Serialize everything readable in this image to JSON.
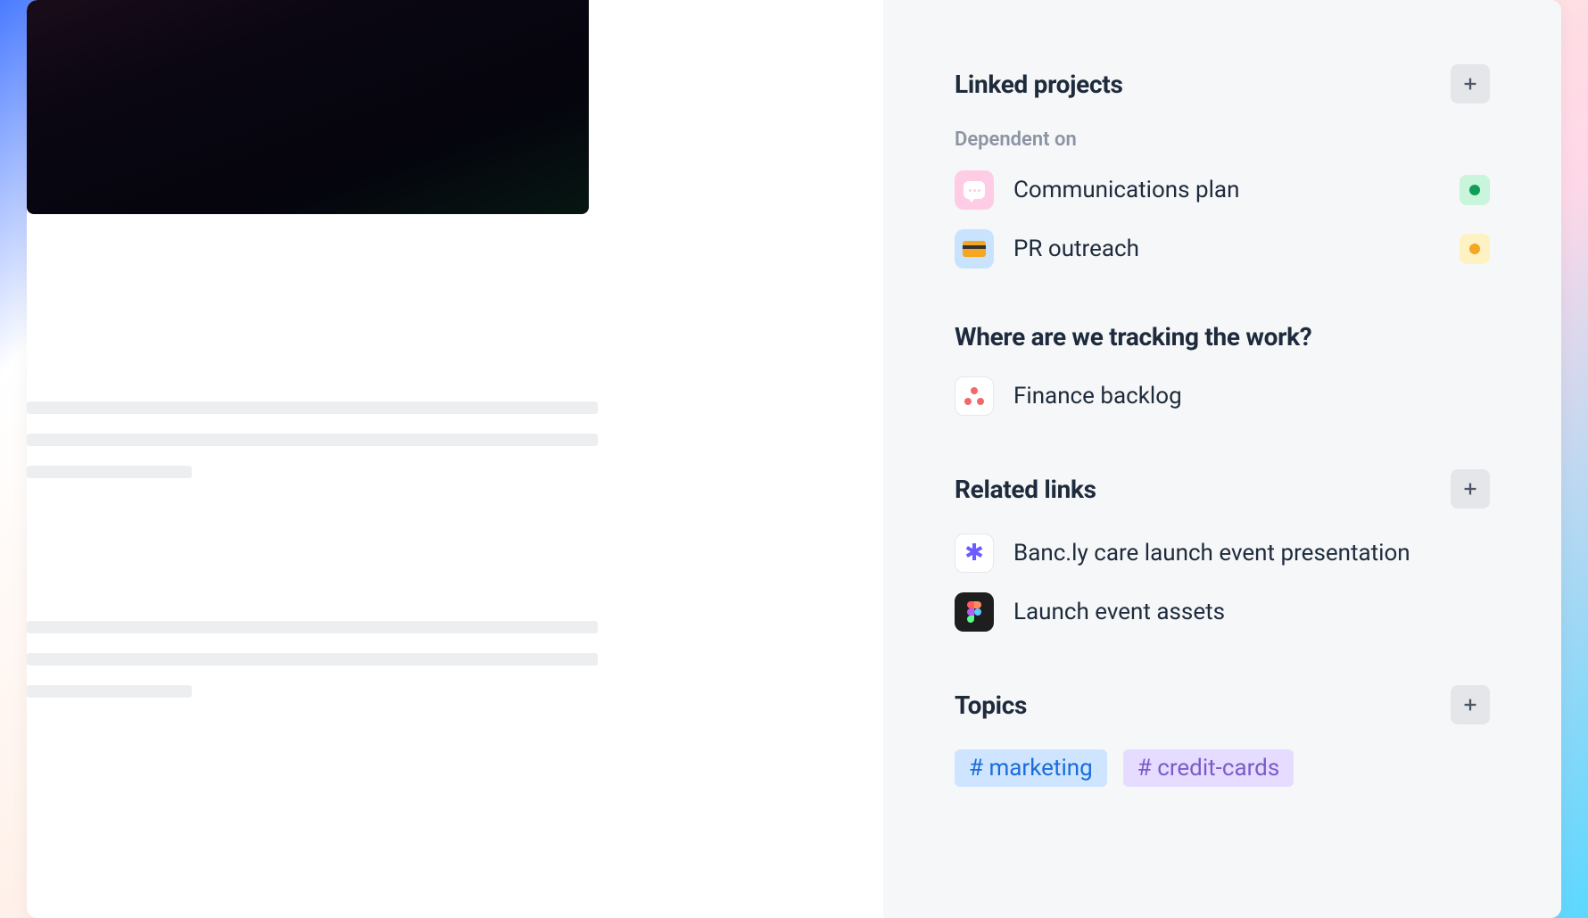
{
  "sidebar": {
    "linked_projects": {
      "title": "Linked projects",
      "subsection": "Dependent on",
      "items": [
        {
          "label": "Communications plan",
          "icon": "chat",
          "status": "green"
        },
        {
          "label": "PR outreach",
          "icon": "card",
          "status": "orange"
        }
      ]
    },
    "tracking": {
      "title": "Where are we tracking the work?",
      "items": [
        {
          "label": "Finance backlog",
          "icon": "asana"
        }
      ]
    },
    "related_links": {
      "title": "Related links",
      "items": [
        {
          "label": "Banc.ly care launch event presentation",
          "icon": "asterisk"
        },
        {
          "label": "Launch event assets",
          "icon": "figma"
        }
      ]
    },
    "topics": {
      "title": "Topics",
      "tags": [
        {
          "label": "marketing",
          "color": "blue"
        },
        {
          "label": "credit-cards",
          "color": "purple"
        }
      ]
    }
  }
}
